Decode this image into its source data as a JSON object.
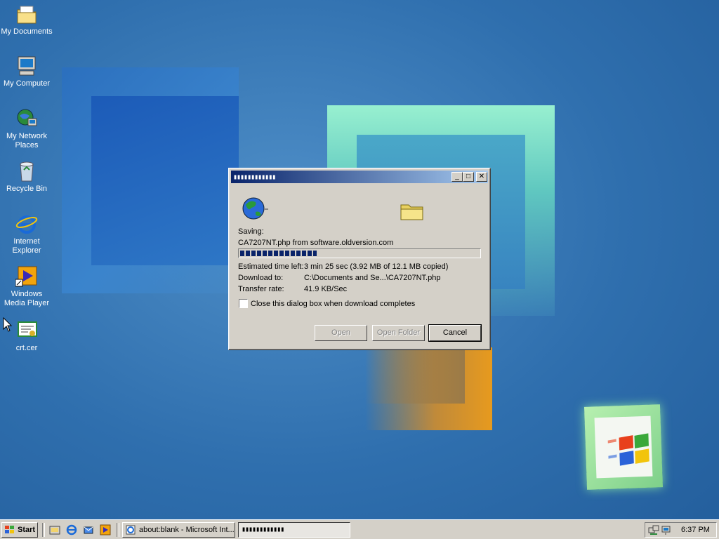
{
  "desktop": {
    "icons": [
      {
        "label": "My Documents",
        "icon": "my-documents-icon"
      },
      {
        "label": "My Computer",
        "icon": "my-computer-icon"
      },
      {
        "label_line1": "My Network",
        "label_line2": "Places",
        "icon": "network-places-icon"
      },
      {
        "label": "Recycle Bin",
        "icon": "recycle-bin-icon"
      },
      {
        "label_line1": "Internet",
        "label_line2": "Explorer",
        "icon": "internet-explorer-icon"
      },
      {
        "label_line1": "Windows",
        "label_line2": "Media Player",
        "icon": "media-player-icon"
      },
      {
        "label": "crt.cer",
        "icon": "certificate-icon"
      }
    ]
  },
  "dialog": {
    "title_progress": "▮▮▮▮▮▮▮▮▮▮▮▮",
    "saving_label": "Saving:",
    "file_line": "CA7207NT.php from software.oldversion.com",
    "progress_fraction": 0.32,
    "rows": [
      {
        "label": "Estimated time left:",
        "value": "3 min 25 sec (3.92 MB of 12.1 MB copied)"
      },
      {
        "label": "Download to:",
        "value": "C:\\Documents and Se...\\CA7207NT.php"
      },
      {
        "label": "Transfer rate:",
        "value": "41.9 KB/Sec"
      }
    ],
    "checkbox_label": "Close this dialog box when download completes",
    "checkbox_checked": false,
    "buttons": {
      "open": "Open",
      "open_folder": "Open Folder",
      "cancel": "Cancel"
    },
    "title_buttons": {
      "minimize": "_",
      "maximize": "□",
      "close": "✕"
    }
  },
  "taskbar": {
    "start_label": "Start",
    "tasks": [
      {
        "label": "about:blank - Microsoft Int..."
      },
      {
        "label": "▮▮▮▮▮▮▮▮▮▮▮▮"
      }
    ],
    "clock": "6:37 PM"
  },
  "colors": {
    "titlebar_start": "#0a246a",
    "titlebar_end": "#a6caf0",
    "face": "#d4d0c8",
    "desktop": "#2f6fae"
  }
}
